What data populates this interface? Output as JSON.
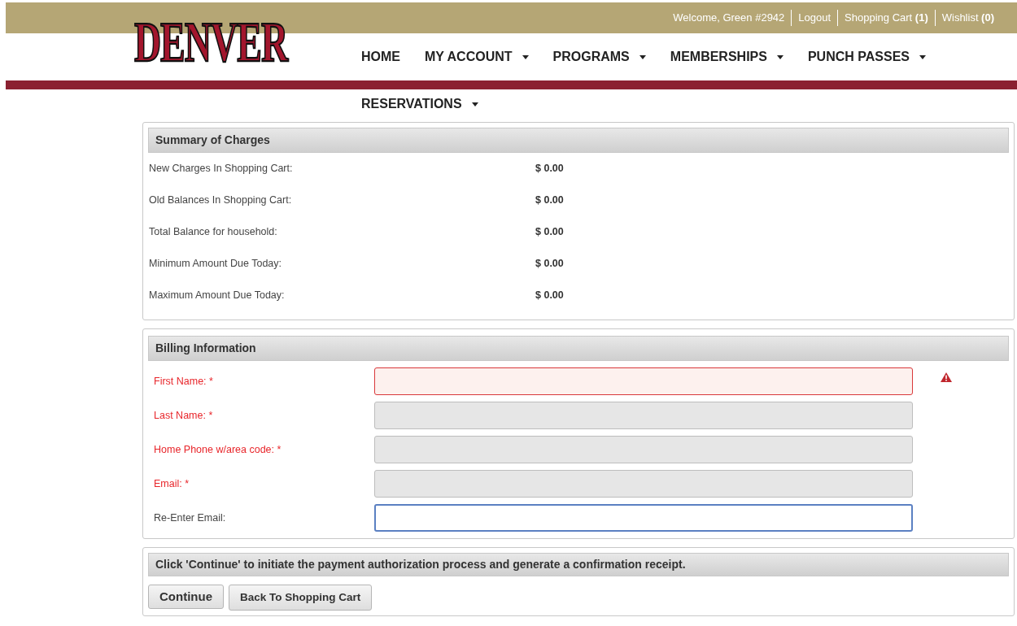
{
  "logo": {
    "text": "DENVER"
  },
  "welcome": "Welcome, Green #2942",
  "top_links": [
    "Logout",
    "Shopping Cart **(1)**",
    "Wishlist **(0)**"
  ],
  "nav": [
    {
      "label": "HOME",
      "dropdown": false
    },
    {
      "label": "MY ACCOUNT",
      "dropdown": true
    },
    {
      "label": "PROGRAMS",
      "dropdown": true
    },
    {
      "label": "MEMBERSHIPS",
      "dropdown": true
    },
    {
      "label": "PUNCH PASSES",
      "dropdown": true
    },
    {
      "label": "RESERVATIONS",
      "dropdown": true
    }
  ],
  "summary": {
    "title": "Summary of Charges",
    "rows": [
      {
        "label": "New Charges In Shopping Cart:",
        "value": "$ 0.00"
      },
      {
        "label": "Old Balances In Shopping Cart:",
        "value": "$ 0.00"
      },
      {
        "label": "Total Balance for household:",
        "value": "$ 0.00"
      },
      {
        "label": "Minimum Amount Due Today:",
        "value": "$ 0.00"
      },
      {
        "label": "Maximum Amount Due Today:",
        "value": "$ 0.00"
      }
    ]
  },
  "billing": {
    "title": "Billing Information",
    "fields": [
      {
        "label": "First Name: *",
        "required": true,
        "kind": "error"
      },
      {
        "label": "Last Name: *",
        "required": true,
        "kind": "empty"
      },
      {
        "label": "Home Phone w/area code: *",
        "required": true,
        "kind": "empty"
      },
      {
        "label": "Email: *",
        "required": true,
        "kind": "empty"
      },
      {
        "label": "Re-Enter Email:",
        "required": false,
        "kind": "focused"
      }
    ]
  },
  "confirm": {
    "message": "Click 'Continue' to initiate the payment authorization process and generate a confirmation receipt.",
    "buttons": [
      {
        "label": "Continue",
        "primary": true
      },
      {
        "label": "Back To Shopping Cart",
        "primary": false
      }
    ]
  }
}
